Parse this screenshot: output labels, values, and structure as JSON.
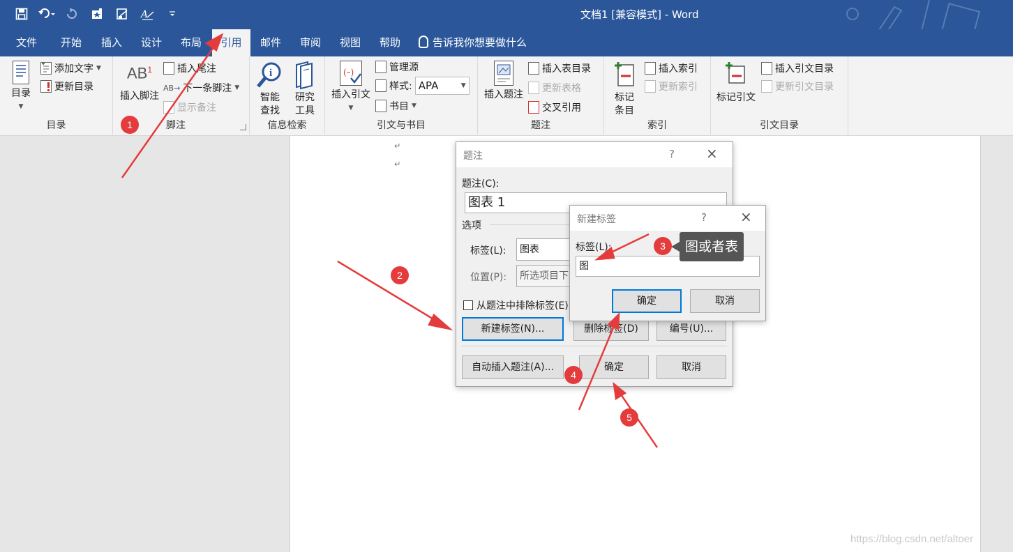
{
  "window": {
    "title": "文档1 [兼容模式] - Word"
  },
  "qat": [
    "save-icon",
    "undo-icon",
    "redo-icon",
    "new-doc-icon",
    "print-preview-icon",
    "format-icon",
    "customize-qat-icon"
  ],
  "tabs": [
    "文件",
    "开始",
    "插入",
    "设计",
    "布局",
    "引用",
    "邮件",
    "审阅",
    "视图",
    "帮助"
  ],
  "active_tab": "引用",
  "tell_me": "告诉我你想要做什么",
  "ribbon": {
    "toc": {
      "label": "目录",
      "toc_button": "目录",
      "add_text": "添加文字",
      "update_toc": "更新目录"
    },
    "footnotes": {
      "label": "脚注",
      "insert_footnote": "插入脚注",
      "insert_endnote": "插入尾注",
      "next_footnote": "下一条脚注",
      "show_notes": "显示备注"
    },
    "research": {
      "label": "信息检索",
      "smart_lookup": "智能\n查找",
      "smart_lookup_1": "智能",
      "smart_lookup_2": "查找",
      "research_1": "研究",
      "research_2": "工具"
    },
    "citations": {
      "label": "引文与书目",
      "insert_citation": "插入引文",
      "manage_sources": "管理源",
      "style_label": "样式:",
      "style_value": "APA",
      "bibliography": "书目"
    },
    "captions": {
      "label": "题注",
      "insert_caption": "插入题注",
      "insert_table_of_figures": "插入表目录",
      "update_table": "更新表格",
      "cross_reference": "交叉引用"
    },
    "index": {
      "label": "索引",
      "mark_entry_1": "标记",
      "mark_entry_2": "条目",
      "insert_index": "插入索引",
      "update_index": "更新索引"
    },
    "toa": {
      "label": "引文目录",
      "mark_citation": "标记引文",
      "insert_toa": "插入引文目录",
      "update_toa": "更新引文目录"
    }
  },
  "document": {
    "paragraph_marks": [
      "↵",
      "↵"
    ],
    "watermark": "https://blog.csdn.net/altoer"
  },
  "caption_dialog": {
    "title": "题注",
    "help": "?",
    "caption_label": "题注(C):",
    "caption_value": "图表  1",
    "options_label": "选项",
    "label_label": "标签(L):",
    "label_value": "图表",
    "position_label": "位置(P):",
    "position_value": "所选项目下方",
    "exclude_label": "从题注中排除标签(E)",
    "new_label_button": "新建标签(N)...",
    "delete_label_button": "删除标签(D)",
    "numbering_button": "编号(U)...",
    "autocaption_button": "自动插入题注(A)...",
    "ok": "确定",
    "cancel": "取消"
  },
  "new_label_dialog": {
    "title": "新建标签",
    "help": "?",
    "label_label": "标签(L):",
    "label_value": "图",
    "ok": "确定",
    "cancel": "取消"
  },
  "annotations": {
    "badges": [
      "1",
      "2",
      "3",
      "4",
      "5"
    ],
    "callout": "图或者表",
    "color": "#e43c3c"
  },
  "colors": {
    "accent": "#2b579a",
    "focus": "#0078d7"
  }
}
